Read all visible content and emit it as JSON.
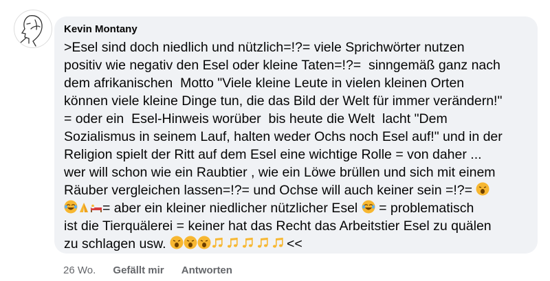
{
  "comment": {
    "author": "Kevin Montany",
    "lines": {
      "l1": ">Esel sind doch niedlich und nützlich=!?= viele Sprichwörter nutzen",
      "l2": "positiv wie negativ den Esel oder kleine Taten=!?=  sinngemäß ganz nach",
      "l3": "dem afrikanischen  Motto \"Viele kleine Leute in vielen kleinen Orten",
      "l4": "können viele kleine Dinge tun, die das Bild der Welt für immer verändern!\"",
      "l5": "= oder ein  Esel-Hinweis worüber  bis heute die Welt  lacht \"Dem",
      "l6": "Sozialismus in seinem Lauf, halten weder Ochs noch Esel auf!\" und in der",
      "l7": "Religion spielt der Ritt auf dem Esel eine wichtige Rolle = von daher ...",
      "l8": "wer will schon wie ein Raubtier , wie ein Löwe brüllen und sich mit einem",
      "l9": "Räuber vergleichen lassen=!?= und Ochse will auch keiner sein =!?= ",
      "l10": "= aber ein kleiner niedlicher nützlicher Esel ",
      "l10b": " = problematisch",
      "l11": "ist die Tierquälerei = keiner hat das Recht das Arbeitstier Esel zu quälen",
      "l12a": "zu schlagen usw. ",
      "l12b": "<<"
    },
    "emoji": {
      "yawn": "yawning-face",
      "joy": "tears-of-joy-face",
      "pray": "folded-hands",
      "bed": "person-in-bed",
      "music": "musical-notes"
    },
    "colors": {
      "emoji_yellow": "#f7b731",
      "tear_blue": "#5aaef2"
    }
  },
  "actions": {
    "time": "26 Wo.",
    "like": "Gefällt mir",
    "reply": "Antworten"
  }
}
